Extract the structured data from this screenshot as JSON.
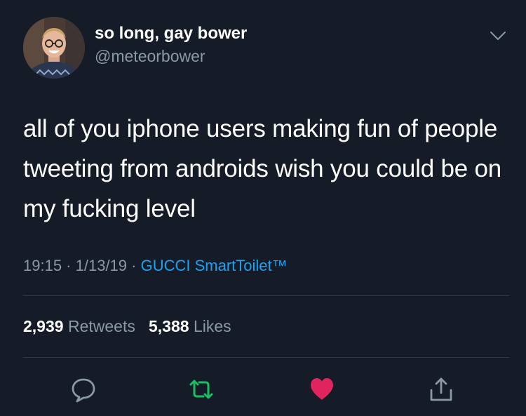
{
  "user": {
    "display_name": "so long, gay bower",
    "handle": "@meteorbower"
  },
  "tweet": {
    "text": "all of you iphone users making fun of people tweeting from androids wish you could be on my fucking level",
    "time": "19:15",
    "separator1": " · ",
    "date": "1/13/19",
    "separator2": " · ",
    "source": "GUCCI SmartToilet™"
  },
  "stats": {
    "retweets_count": "2,939",
    "retweets_label": "Retweets",
    "likes_count": "5,388",
    "likes_label": "Likes"
  },
  "icons": {
    "reply": "reply-icon",
    "retweet": "retweet-icon",
    "like": "heart-icon",
    "share": "share-icon",
    "menu": "chevron-down-icon"
  },
  "colors": {
    "background": "#151c28",
    "secondary_text": "#8b98a5",
    "link": "#1da1f2",
    "retweet_green": "#17bf63",
    "like_red": "#e0245e"
  }
}
